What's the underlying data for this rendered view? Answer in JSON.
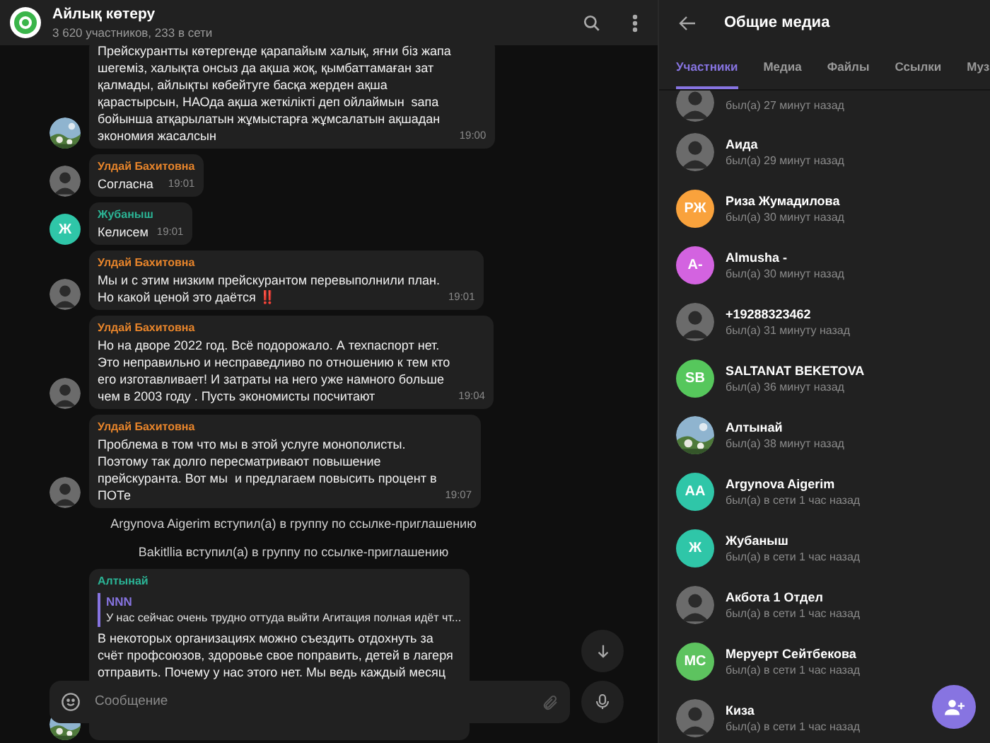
{
  "chat": {
    "title": "Айлық көтеру",
    "subtitle": "3 620 участников, 233 в сети",
    "messages": [
      {
        "kind": "message",
        "text": "Прейскурантты көтергенде қарапайым халық, яғни біз жапа\nшегеміз, халықта онсыз да ақша жоқ, қымбаттамаған зат\nқалмады, айлықты көбейтуге басқа жерден ақша\nқарастырсын, НАОда ақша жеткілікті деп ойлаймын  sапа\nбойынша атқарылатын жұмыстарға жұмсалатын ақшадан\nэкономия жасалсын",
        "time": "19:00"
      },
      {
        "kind": "message",
        "author": "Улдай Бахитовна",
        "color": "#e8852b",
        "text": "Согласна",
        "time": "19:01"
      },
      {
        "kind": "message",
        "author": "Жубаныш",
        "color": "#2bb596",
        "avatar": {
          "kind": "letters",
          "letters": "Ж",
          "color": "#2fc6a8"
        },
        "text": "Келисем",
        "time": "19:01"
      },
      {
        "kind": "message",
        "author": "Улдай Бахитовна",
        "color": "#e8852b",
        "text": "Мы и с этим низким прейскурантом перевыполнили план.\nНо какой ценой это даётся **‼️**",
        "time": "19:01"
      },
      {
        "kind": "message",
        "author": "Улдай Бахитовна",
        "color": "#e8852b",
        "text": "Но на дворе 2022 год. Всё подорожало. А техпаспорт нет.\nЭто неправильно и несправедливо по отношению к тем кто\nего изготавливает! И затраты на него уже намного больше\nчем в 2003 году . Пусть экономисты посчитают",
        "time": "19:04"
      },
      {
        "kind": "message",
        "author": "Улдай Бахитовна",
        "color": "#e8852b",
        "text": "Проблема в том что мы в этой услуге монополисты.\nПоэтому так долго пересматривают повышение\nпрейскуранта. Вот мы  и предлагаем повысить процент в\nПОТе",
        "time": "19:07"
      },
      {
        "kind": "service",
        "text": "Argynova Aigerim вступил(а) в группу по ссылке-приглашению"
      },
      {
        "kind": "service",
        "text": "Bakitllia вступил(а) в группу по ссылке-приглашению"
      },
      {
        "kind": "message",
        "author": "Алтынай",
        "color": "#2bb596",
        "reply": {
          "author": "NNN",
          "text": "У нас сейчас очень трудно оттуда выйти Агитация полная идёт чт..."
        },
        "text": "В некоторых организациях можно съездить отдохнуть за\nсчёт профсоюзов, здоровье свое поправить, детей в лагеря\nотправить. Почему у нас этого нет. Мы ведь каждый месяц"
      }
    ],
    "composer": {
      "placeholder": "Сообщение"
    }
  },
  "panel": {
    "title": "Общие медиа",
    "tabs": [
      {
        "label": "Участники",
        "selected": true
      },
      {
        "label": "Медиа",
        "selected": false
      },
      {
        "label": "Файлы",
        "selected": false
      },
      {
        "label": "Ссылки",
        "selected": false
      },
      {
        "label": "Муз",
        "selected": false
      }
    ],
    "members": [
      {
        "status": "был(а) 27 минут назад"
      },
      {
        "name": "Аида",
        "status": "был(а) 29 минут назад"
      },
      {
        "name": "Риза Жумадилова",
        "status": "был(а) 30 минут назад",
        "avatar": {
          "kind": "letters",
          "letters": "РЖ",
          "color": "#f9a23c"
        }
      },
      {
        "name": "Almusha -",
        "status": "был(а) 30 минут назад",
        "avatar": {
          "kind": "letters",
          "letters": "A-",
          "color": "#d363e0"
        }
      },
      {
        "name": "+19288323462",
        "status": "был(а) 31 минуту назад"
      },
      {
        "name": "SALTANAT BEKETOVA",
        "status": "был(а) 36 минут назад",
        "avatar": {
          "kind": "letters",
          "letters": "SB",
          "color": "#56c75c"
        }
      },
      {
        "name": "Алтынай",
        "status": "был(а) 38 минут назад"
      },
      {
        "name": "Argynova Aigerim",
        "status": "был(а) в сети 1 час назад",
        "avatar": {
          "kind": "letters",
          "letters": "AA",
          "color": "#2fc6a8"
        }
      },
      {
        "name": "Жубаныш",
        "status": "был(а) в сети 1 час назад",
        "avatar": {
          "kind": "letters",
          "letters": "Ж",
          "color": "#2fc6a8"
        }
      },
      {
        "name": "Акбота 1 Отдел",
        "status": "был(а) в сети 1 час назад"
      },
      {
        "name": "Меруерт Сейтбекова",
        "status": "был(а) в сети 1 час назад",
        "avatar": {
          "kind": "letters",
          "letters": "МС",
          "color": "#5dc35f"
        }
      },
      {
        "name": "Киза",
        "status": "был(а) в сети 1 час назад"
      }
    ]
  }
}
